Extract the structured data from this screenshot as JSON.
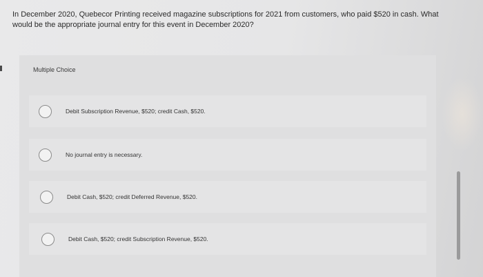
{
  "question": {
    "text": "In December 2020, Quebecor Printing received magazine subscriptions for 2021 from customers, who paid $520 in cash. What would be the appropriate journal entry for this event in December 2020?"
  },
  "multiple_choice": {
    "label": "Multiple Choice",
    "options": [
      {
        "text": "Debit Subscription Revenue, $520; credit Cash, $520."
      },
      {
        "text": "No journal entry is necessary."
      },
      {
        "text": "Debit Cash, $520; credit Deferred Revenue, $520."
      },
      {
        "text": "Debit Cash, $520; credit Subscription Revenue, $520."
      }
    ]
  }
}
